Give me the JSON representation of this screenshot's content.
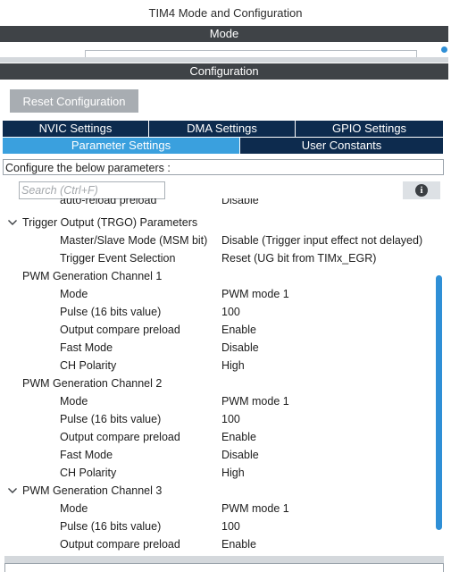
{
  "window": {
    "title": "TIM4 Mode and Configuration"
  },
  "mode_section": {
    "header": "Mode"
  },
  "config_section": {
    "header": "Configuration"
  },
  "toolbar": {
    "reset_label": "Reset Configuration"
  },
  "tabs": {
    "row1": [
      {
        "label": "NVIC Settings"
      },
      {
        "label": "DMA Settings"
      },
      {
        "label": "GPIO Settings"
      }
    ],
    "row2": [
      {
        "label": "Parameter Settings",
        "active": true
      },
      {
        "label": "User Constants"
      }
    ]
  },
  "description": "Configure the below parameters :",
  "search": {
    "placeholder": "Search (Ctrl+F)"
  },
  "tree": {
    "clipped_row": {
      "name": "auto-reload preload",
      "value": "Disable"
    },
    "groups": [
      {
        "title": "Trigger Output (TRGO) Parameters",
        "expanded": true,
        "params": [
          {
            "name": "Master/Slave Mode (MSM bit)",
            "value": "Disable (Trigger input effect not delayed)"
          },
          {
            "name": "Trigger Event Selection",
            "value": "Reset (UG bit from TIMx_EGR)"
          }
        ]
      },
      {
        "title": "PWM Generation Channel 1",
        "expanded": null,
        "params": [
          {
            "name": "Mode",
            "value": "PWM mode 1"
          },
          {
            "name": "Pulse (16 bits value)",
            "value": "100"
          },
          {
            "name": "Output compare preload",
            "value": "Enable"
          },
          {
            "name": "Fast Mode",
            "value": "Disable"
          },
          {
            "name": "CH Polarity",
            "value": "High"
          }
        ]
      },
      {
        "title": "PWM Generation Channel 2",
        "expanded": null,
        "params": [
          {
            "name": "Mode",
            "value": "PWM mode 1"
          },
          {
            "name": "Pulse (16 bits value)",
            "value": "100"
          },
          {
            "name": "Output compare preload",
            "value": "Enable"
          },
          {
            "name": "Fast Mode",
            "value": "Disable"
          },
          {
            "name": "CH Polarity",
            "value": "High"
          }
        ]
      },
      {
        "title": "PWM Generation Channel 3",
        "expanded": true,
        "params": [
          {
            "name": "Mode",
            "value": "PWM mode 1"
          },
          {
            "name": "Pulse (16 bits value)",
            "value": "100"
          },
          {
            "name": "Output compare preload",
            "value": "Enable"
          }
        ]
      }
    ]
  },
  "colors": {
    "section_header": "#3f4347",
    "tab_dark": "#0d2b4e",
    "tab_active": "#3aa0de",
    "scroll_thumb": "#2f8fd6",
    "reset_button": "#a8adb2"
  },
  "icons": {
    "info": "info-circle-icon",
    "expand": "chevron-down-icon"
  }
}
